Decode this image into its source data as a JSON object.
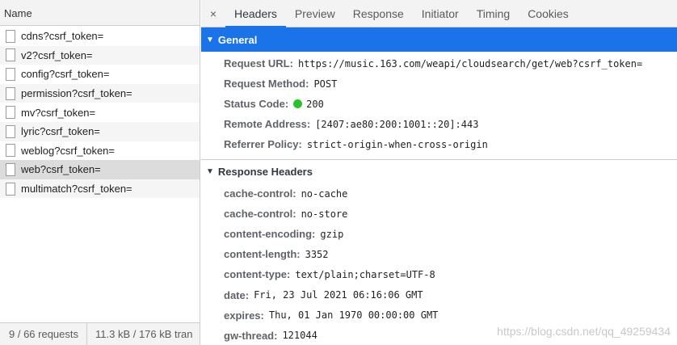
{
  "left": {
    "column_header": "Name",
    "requests": [
      {
        "name": "cdns?csrf_token="
      },
      {
        "name": "v2?csrf_token="
      },
      {
        "name": "config?csrf_token="
      },
      {
        "name": "permission?csrf_token="
      },
      {
        "name": "mv?csrf_token="
      },
      {
        "name": "lyric?csrf_token="
      },
      {
        "name": "weblog?csrf_token="
      },
      {
        "name": "web?csrf_token="
      },
      {
        "name": "multimatch?csrf_token="
      }
    ],
    "status": {
      "requests": "9 / 66 requests",
      "transferred": "11.3 kB / 176 kB tran"
    }
  },
  "tabs": {
    "close": "×",
    "items": [
      "Headers",
      "Preview",
      "Response",
      "Initiator",
      "Timing",
      "Cookies"
    ],
    "active": "Headers"
  },
  "general": {
    "title": "General",
    "rows": [
      {
        "key": "Request URL:",
        "value": "https://music.163.com/weapi/cloudsearch/get/web?csrf_token="
      },
      {
        "key": "Request Method:",
        "value": "POST"
      },
      {
        "key": "Status Code:",
        "value": "200"
      },
      {
        "key": "Remote Address:",
        "value": "[2407:ae80:200:1001::20]:443"
      },
      {
        "key": "Referrer Policy:",
        "value": "strict-origin-when-cross-origin"
      }
    ]
  },
  "response_headers": {
    "title": "Response Headers",
    "rows": [
      {
        "key": "cache-control:",
        "value": "no-cache"
      },
      {
        "key": "cache-control:",
        "value": "no-store"
      },
      {
        "key": "content-encoding:",
        "value": "gzip"
      },
      {
        "key": "content-length:",
        "value": "3352"
      },
      {
        "key": "content-type:",
        "value": "text/plain;charset=UTF-8"
      },
      {
        "key": "date:",
        "value": "Fri, 23 Jul 2021 06:16:06 GMT"
      },
      {
        "key": "expires:",
        "value": "Thu, 01 Jan 1970 00:00:00 GMT"
      },
      {
        "key": "gw-thread:",
        "value": "121044"
      }
    ]
  },
  "watermark": "https://blog.csdn.net/qq_49259434",
  "colors": {
    "accent": "#1a73e8",
    "status_ok": "#2bc12b"
  }
}
